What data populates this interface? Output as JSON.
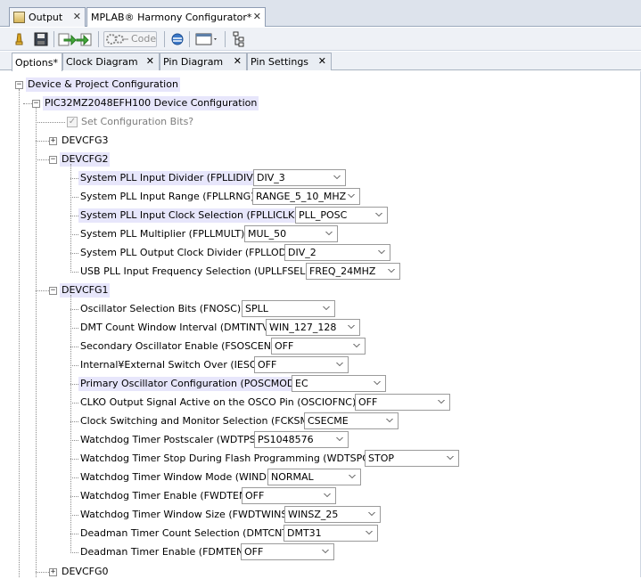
{
  "doc_tabs": [
    {
      "label": "Output",
      "icon": "output-window-icon",
      "active": false
    },
    {
      "label": "MPLAB® Harmony Configurator*",
      "icon": "harmony-icon",
      "active": true
    }
  ],
  "toolbar": {
    "buttons": [
      "pin-icon",
      "save-icon",
      "import-icon",
      "export-icon",
      "generate-code-icon",
      "refresh-icon",
      "view-window-icon",
      "tree-view-icon"
    ],
    "code_label": "Code"
  },
  "view_tabs": [
    {
      "label": "Options*",
      "active": true
    },
    {
      "label": "Clock Diagram",
      "active": false
    },
    {
      "label": "Pin Diagram",
      "active": false
    },
    {
      "label": "Pin Settings",
      "active": false
    }
  ],
  "tree": {
    "root": "Device & Project Configuration",
    "device": "PIC32MZ2048EFH100 Device Configuration",
    "set_config_bits": "Set Configuration Bits?",
    "devcfg3": "DEVCFG3",
    "devcfg2": {
      "label": "DEVCFG2",
      "items": [
        {
          "label": "System PLL Input Divider (FPLLIDIV)",
          "value": "DIV_3",
          "highlight": true
        },
        {
          "label": "System PLL Input Range (FPLLRNG)",
          "value": "RANGE_5_10_MHZ",
          "highlight": false
        },
        {
          "label": "System PLL Input Clock Selection (FPLLICLK)",
          "value": "PLL_POSC",
          "highlight": true
        },
        {
          "label": "System PLL Multiplier (FPLLMULT)",
          "value": "MUL_50",
          "highlight": false
        },
        {
          "label": "System PLL Output Clock Divider (FPLLODIV)",
          "value": "DIV_2",
          "highlight": false
        },
        {
          "label": "USB PLL Input Frequency Selection (UPLLFSEL)",
          "value": "FREQ_24MHZ",
          "highlight": false
        }
      ]
    },
    "devcfg1": {
      "label": "DEVCFG1",
      "items": [
        {
          "label": "Oscillator Selection Bits (FNOSC)",
          "value": "SPLL",
          "highlight": false
        },
        {
          "label": "DMT Count Window Interval (DMTINTV)",
          "value": "WIN_127_128",
          "highlight": false
        },
        {
          "label": "Secondary Oscillator Enable (FSOSCEN)",
          "value": "OFF",
          "highlight": false
        },
        {
          "label": "Internal¥External Switch Over (IESO)",
          "value": "OFF",
          "highlight": false
        },
        {
          "label": "Primary Oscillator Configuration (POSCMOD)",
          "value": "EC",
          "highlight": true
        },
        {
          "label": "CLKO Output Signal Active on the OSCO Pin (OSCIOFNC)",
          "value": "OFF",
          "highlight": false
        },
        {
          "label": "Clock Switching and Monitor Selection (FCKSM)",
          "value": "CSECME",
          "highlight": false
        },
        {
          "label": "Watchdog Timer Postscaler (WDTPS)",
          "value": "PS1048576",
          "highlight": false
        },
        {
          "label": "Watchdog Timer Stop During Flash Programming (WDTSPGM)",
          "value": "STOP",
          "highlight": false
        },
        {
          "label": "Watchdog Timer Window Mode (WINDIS)",
          "value": "NORMAL",
          "highlight": false
        },
        {
          "label": "Watchdog Timer Enable (FWDTEN)",
          "value": "OFF",
          "highlight": false
        },
        {
          "label": "Watchdog Timer Window Size (FWDTWINSZ)",
          "value": "WINSZ_25",
          "highlight": false
        },
        {
          "label": "Deadman Timer Count Selection (DMTCNT)",
          "value": "DMT31",
          "highlight": false
        },
        {
          "label": "Deadman Timer Enable (FDMTEN)",
          "value": "OFF",
          "highlight": false
        }
      ]
    },
    "devcfg0": "DEVCFG0"
  },
  "colors": {
    "highlight": "#e7e6fb",
    "tab_strip": "#dde3ec",
    "toolbar": "#eef1f6"
  }
}
